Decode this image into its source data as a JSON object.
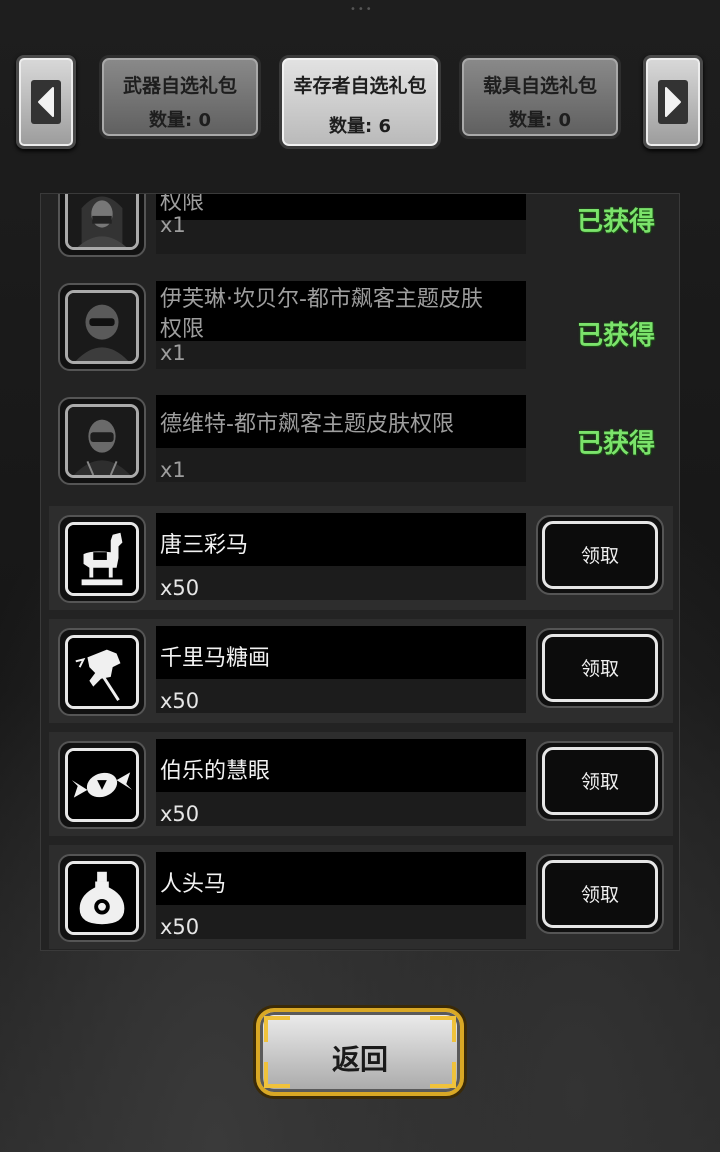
{
  "tabs": [
    {
      "name": "武器自选礼包",
      "count": "数量: 0",
      "active": false
    },
    {
      "name": "幸存者自选礼包",
      "count": "数量: 6",
      "active": true
    },
    {
      "name": "载具自选礼包",
      "count": "数量: 0",
      "active": false
    }
  ],
  "items": [
    {
      "name_line1": "",
      "name_line2": "权限",
      "qty": "x1",
      "status": "已获得",
      "icon": "masked-woman-portrait-icon"
    },
    {
      "name_line1": "伊芙琳·坎贝尔-都市飙客主题皮肤",
      "name_line2": "权限",
      "qty": "x1",
      "status": "已获得",
      "icon": "helmet-rider-portrait-icon"
    },
    {
      "name_line1": "德维特-都市飙客主题皮肤权限",
      "name_line2": "",
      "qty": "x1",
      "status": "已获得",
      "icon": "masked-man-portrait-icon"
    },
    {
      "name_line1": "唐三彩马",
      "qty": "x50",
      "action": "领取",
      "icon": "tang-horse-icon"
    },
    {
      "name_line1": "千里马糖画",
      "qty": "x50",
      "action": "领取",
      "icon": "horse-candy-icon"
    },
    {
      "name_line1": "伯乐的慧眼",
      "qty": "x50",
      "action": "领取",
      "icon": "candy-icon"
    },
    {
      "name_line1": "人头马",
      "qty": "x50",
      "action": "领取",
      "icon": "bottle-icon"
    }
  ],
  "back_label": "返回",
  "colors": {
    "obtained": "#7be36b",
    "accent_gold": "#d9a825"
  }
}
